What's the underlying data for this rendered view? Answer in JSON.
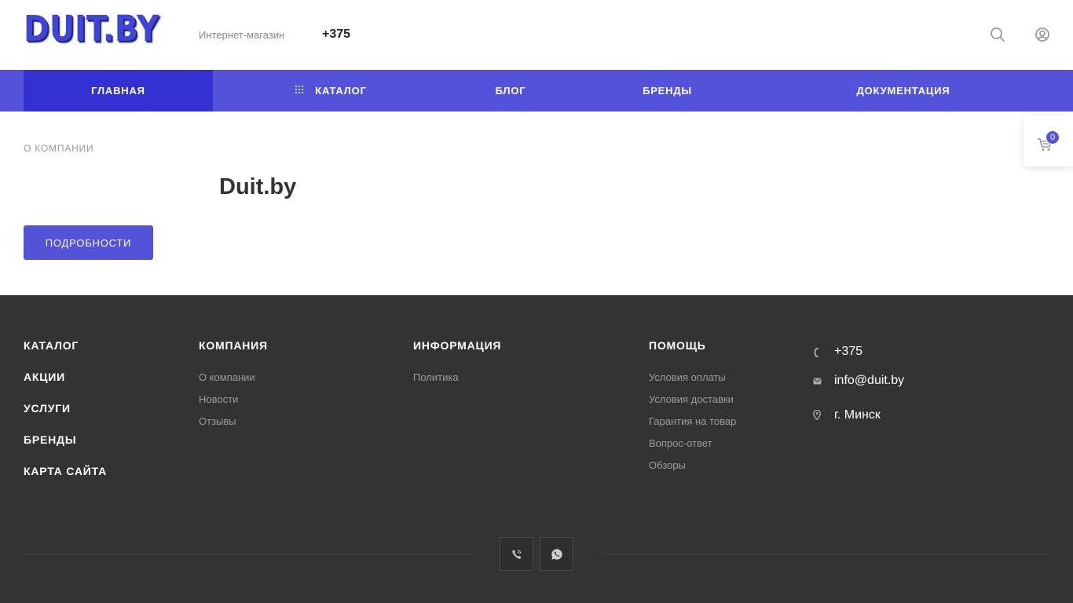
{
  "header": {
    "logo_text": "DUIT.BY",
    "tagline": "Интернет-магазин",
    "phone": "+375",
    "icons": [
      "search-icon",
      "user-icon"
    ]
  },
  "nav": {
    "items": [
      {
        "label": "ГЛАВНАЯ",
        "active": true
      },
      {
        "label": "КАТАЛОГ",
        "icon": "grid-icon"
      },
      {
        "label": "БЛОГ"
      },
      {
        "label": "БРЕНДЫ"
      },
      {
        "label": "ДОКУМЕНТАЦИЯ"
      }
    ]
  },
  "main": {
    "breadcrumb": "О КОМПАНИИ",
    "title": "Duit.by",
    "details_button": "ПОДРОБНОСТИ"
  },
  "cart": {
    "icon": "cart-icon",
    "count": "0"
  },
  "footer": {
    "col1": [
      "КАТАЛОГ",
      "АКЦИИ",
      "УСЛУГИ",
      "БРЕНДЫ",
      "КАРТА САЙТА"
    ],
    "company": {
      "heading": "КОМПАНИЯ",
      "links": [
        "О компании",
        "Новости",
        "Отзывы"
      ]
    },
    "info": {
      "heading": "ИНФОРМАЦИЯ",
      "links": [
        "Политика"
      ]
    },
    "help": {
      "heading": "ПОМОЩЬ",
      "links": [
        "Условия оплаты",
        "Условия доставки",
        "Гарантия на товар",
        "Вопрос-ответ",
        "Обзоры"
      ]
    },
    "contacts": {
      "phone": "+375",
      "email": "info@duit.by",
      "address": "г. Минск"
    },
    "social": [
      "viber-icon",
      "whatsapp-icon"
    ]
  },
  "colors": {
    "accent": "#5452d9",
    "accent_active": "#3331d1",
    "footer_bg": "#333333"
  }
}
